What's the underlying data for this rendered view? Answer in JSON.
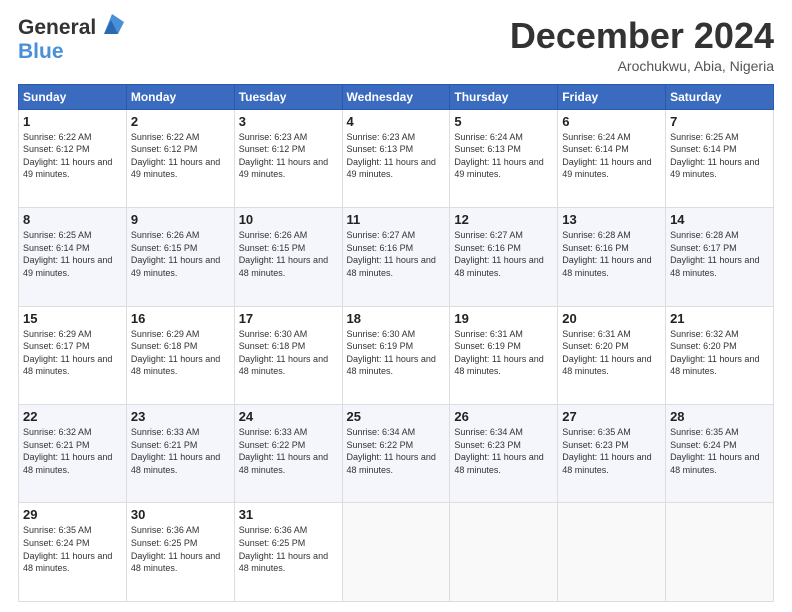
{
  "header": {
    "logo_general": "General",
    "logo_blue": "Blue",
    "month_title": "December 2024",
    "location": "Arochukwu, Abia, Nigeria"
  },
  "days_of_week": [
    "Sunday",
    "Monday",
    "Tuesday",
    "Wednesday",
    "Thursday",
    "Friday",
    "Saturday"
  ],
  "weeks": [
    [
      {
        "day": "1",
        "sunrise": "6:22 AM",
        "sunset": "6:12 PM",
        "daylight": "11 hours and 49 minutes."
      },
      {
        "day": "2",
        "sunrise": "6:22 AM",
        "sunset": "6:12 PM",
        "daylight": "11 hours and 49 minutes."
      },
      {
        "day": "3",
        "sunrise": "6:23 AM",
        "sunset": "6:12 PM",
        "daylight": "11 hours and 49 minutes."
      },
      {
        "day": "4",
        "sunrise": "6:23 AM",
        "sunset": "6:13 PM",
        "daylight": "11 hours and 49 minutes."
      },
      {
        "day": "5",
        "sunrise": "6:24 AM",
        "sunset": "6:13 PM",
        "daylight": "11 hours and 49 minutes."
      },
      {
        "day": "6",
        "sunrise": "6:24 AM",
        "sunset": "6:14 PM",
        "daylight": "11 hours and 49 minutes."
      },
      {
        "day": "7",
        "sunrise": "6:25 AM",
        "sunset": "6:14 PM",
        "daylight": "11 hours and 49 minutes."
      }
    ],
    [
      {
        "day": "8",
        "sunrise": "6:25 AM",
        "sunset": "6:14 PM",
        "daylight": "11 hours and 49 minutes."
      },
      {
        "day": "9",
        "sunrise": "6:26 AM",
        "sunset": "6:15 PM",
        "daylight": "11 hours and 49 minutes."
      },
      {
        "day": "10",
        "sunrise": "6:26 AM",
        "sunset": "6:15 PM",
        "daylight": "11 hours and 48 minutes."
      },
      {
        "day": "11",
        "sunrise": "6:27 AM",
        "sunset": "6:16 PM",
        "daylight": "11 hours and 48 minutes."
      },
      {
        "day": "12",
        "sunrise": "6:27 AM",
        "sunset": "6:16 PM",
        "daylight": "11 hours and 48 minutes."
      },
      {
        "day": "13",
        "sunrise": "6:28 AM",
        "sunset": "6:16 PM",
        "daylight": "11 hours and 48 minutes."
      },
      {
        "day": "14",
        "sunrise": "6:28 AM",
        "sunset": "6:17 PM",
        "daylight": "11 hours and 48 minutes."
      }
    ],
    [
      {
        "day": "15",
        "sunrise": "6:29 AM",
        "sunset": "6:17 PM",
        "daylight": "11 hours and 48 minutes."
      },
      {
        "day": "16",
        "sunrise": "6:29 AM",
        "sunset": "6:18 PM",
        "daylight": "11 hours and 48 minutes."
      },
      {
        "day": "17",
        "sunrise": "6:30 AM",
        "sunset": "6:18 PM",
        "daylight": "11 hours and 48 minutes."
      },
      {
        "day": "18",
        "sunrise": "6:30 AM",
        "sunset": "6:19 PM",
        "daylight": "11 hours and 48 minutes."
      },
      {
        "day": "19",
        "sunrise": "6:31 AM",
        "sunset": "6:19 PM",
        "daylight": "11 hours and 48 minutes."
      },
      {
        "day": "20",
        "sunrise": "6:31 AM",
        "sunset": "6:20 PM",
        "daylight": "11 hours and 48 minutes."
      },
      {
        "day": "21",
        "sunrise": "6:32 AM",
        "sunset": "6:20 PM",
        "daylight": "11 hours and 48 minutes."
      }
    ],
    [
      {
        "day": "22",
        "sunrise": "6:32 AM",
        "sunset": "6:21 PM",
        "daylight": "11 hours and 48 minutes."
      },
      {
        "day": "23",
        "sunrise": "6:33 AM",
        "sunset": "6:21 PM",
        "daylight": "11 hours and 48 minutes."
      },
      {
        "day": "24",
        "sunrise": "6:33 AM",
        "sunset": "6:22 PM",
        "daylight": "11 hours and 48 minutes."
      },
      {
        "day": "25",
        "sunrise": "6:34 AM",
        "sunset": "6:22 PM",
        "daylight": "11 hours and 48 minutes."
      },
      {
        "day": "26",
        "sunrise": "6:34 AM",
        "sunset": "6:23 PM",
        "daylight": "11 hours and 48 minutes."
      },
      {
        "day": "27",
        "sunrise": "6:35 AM",
        "sunset": "6:23 PM",
        "daylight": "11 hours and 48 minutes."
      },
      {
        "day": "28",
        "sunrise": "6:35 AM",
        "sunset": "6:24 PM",
        "daylight": "11 hours and 48 minutes."
      }
    ],
    [
      {
        "day": "29",
        "sunrise": "6:35 AM",
        "sunset": "6:24 PM",
        "daylight": "11 hours and 48 minutes."
      },
      {
        "day": "30",
        "sunrise": "6:36 AM",
        "sunset": "6:25 PM",
        "daylight": "11 hours and 48 minutes."
      },
      {
        "day": "31",
        "sunrise": "6:36 AM",
        "sunset": "6:25 PM",
        "daylight": "11 hours and 48 minutes."
      },
      null,
      null,
      null,
      null
    ]
  ],
  "labels": {
    "sunrise": "Sunrise:",
    "sunset": "Sunset:",
    "daylight": "Daylight:"
  }
}
